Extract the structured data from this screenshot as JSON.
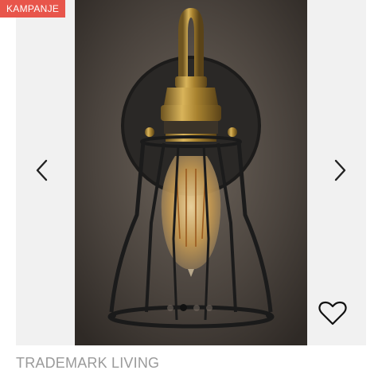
{
  "badge": {
    "label": "KAMPANJE",
    "color": "#e8554b"
  },
  "gallery": {
    "prev_icon": "chevron-left-icon",
    "next_icon": "chevron-right-icon",
    "dot_count": 4,
    "active_dot": 2,
    "wishlist_icon": "heart-icon"
  },
  "product": {
    "brand": "TRADEMARK LIVING"
  }
}
